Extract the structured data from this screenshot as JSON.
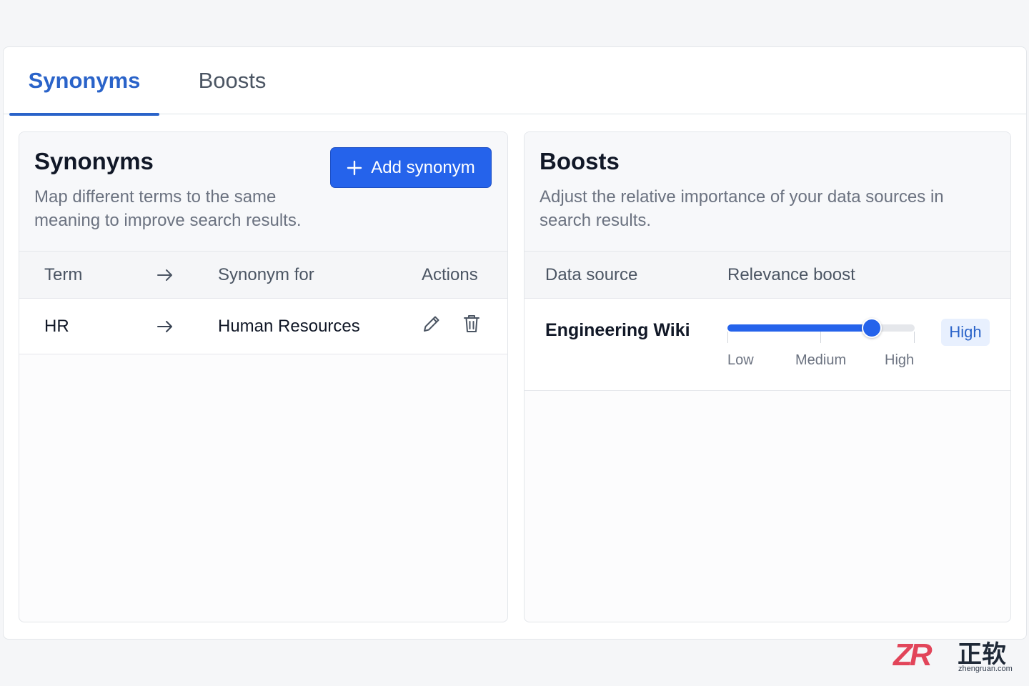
{
  "tabs": [
    {
      "label": "Synonyms",
      "active": true
    },
    {
      "label": "Boosts",
      "active": false
    }
  ],
  "synonyms": {
    "title": "Synonyms",
    "description": "Map different terms to the same meaning to improve search results.",
    "add_button_label": "Add synonym",
    "columns": {
      "term": "Term",
      "arrow": "→",
      "synonym_for": "Synonym for",
      "actions": "Actions"
    },
    "rows": [
      {
        "term": "HR",
        "arrow": "→",
        "synonym_for": "Human Resources"
      }
    ]
  },
  "boosts": {
    "title": "Boosts",
    "description": "Adjust the relative importance of your data sources in search results.",
    "columns": {
      "data_source": "Data source",
      "relevance_boost": "Relevance boost"
    },
    "rows": [
      {
        "data_source": "Engineering Wiki",
        "boost_level_fraction": 0.77,
        "boost_value": "High",
        "scale_labels": [
          "Low",
          "Medium",
          "High"
        ]
      }
    ]
  },
  "watermark": {
    "logo": "ZR",
    "brand": "正软",
    "url": "zhengruan.com"
  },
  "colors": {
    "accent": "#2563eb",
    "tab_active": "#2a63c9",
    "badge_bg": "#e8f0fe"
  },
  "icons": [
    "plus-icon",
    "arrow-right-icon",
    "pencil-icon",
    "trash-icon"
  ]
}
